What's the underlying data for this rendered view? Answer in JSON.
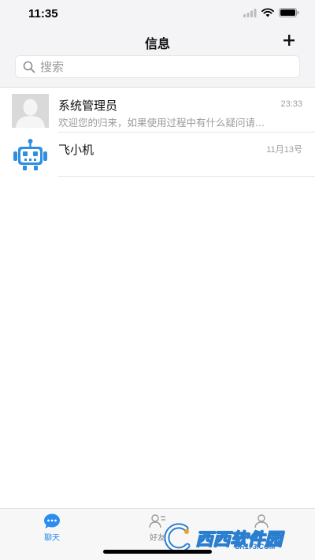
{
  "status_bar": {
    "time": "11:35"
  },
  "header": {
    "title": "信息",
    "add_icon": "plus-icon"
  },
  "search": {
    "placeholder": "搜索",
    "value": ""
  },
  "chats": [
    {
      "name": "系统管理员",
      "time": "23:33",
      "preview": "欢迎您的归来，如果使用过程中有什么疑问请...",
      "avatar_icon": "default-user-avatar"
    },
    {
      "name": "飞小机",
      "time": "11月13号",
      "preview": "",
      "avatar_icon": "robot-avatar"
    }
  ],
  "tabbar": {
    "tabs": [
      {
        "label": "聊天",
        "icon": "chat-bubble-icon",
        "active": true
      },
      {
        "label": "好友",
        "icon": "contacts-icon",
        "active": false
      },
      {
        "label": "",
        "icon": "profile-icon",
        "active": false
      }
    ]
  },
  "watermark": {
    "text": "西西软件园",
    "sub": "CR173.COM"
  },
  "colors": {
    "accent": "#2c8df0",
    "header_bg": "#f4f4f6",
    "robot": "#2e8fe0"
  }
}
